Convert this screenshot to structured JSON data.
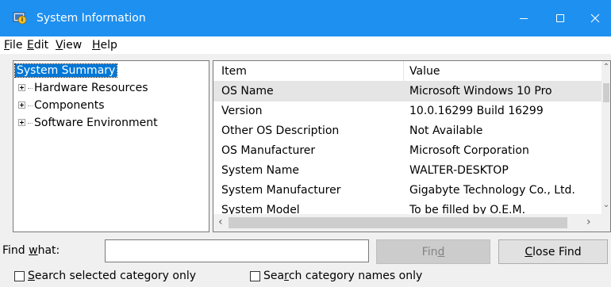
{
  "window": {
    "title": "System Information",
    "titlebar_color": "#1e90f0",
    "icons": [
      "system-info-icon",
      "minimize-icon",
      "maximize-icon",
      "close-icon"
    ]
  },
  "menu": {
    "file": {
      "mnemonic": "F",
      "rest": "ile"
    },
    "edit": {
      "mnemonic": "E",
      "rest": "dit"
    },
    "view": {
      "mnemonic": "V",
      "rest": "iew"
    },
    "help": {
      "mnemonic": "H",
      "rest": "elp"
    }
  },
  "tree": {
    "root": "System Summary",
    "children": [
      "Hardware Resources",
      "Components",
      "Software Environment"
    ]
  },
  "list": {
    "columns": [
      "Item",
      "Value"
    ],
    "rows": [
      {
        "item": "OS Name",
        "value": "Microsoft Windows 10 Pro"
      },
      {
        "item": "Version",
        "value": "10.0.16299 Build 16299"
      },
      {
        "item": "Other OS Description",
        "value": "Not Available"
      },
      {
        "item": "OS Manufacturer",
        "value": "Microsoft Corporation"
      },
      {
        "item": "System Name",
        "value": "WALTER-DESKTOP"
      },
      {
        "item": "System Manufacturer",
        "value": "Gigabyte Technology Co., Ltd."
      },
      {
        "item": "System Model",
        "value": "To be filled by O.E.M."
      }
    ],
    "selected_row": 0,
    "selection_color": "#e5e5e5"
  },
  "find": {
    "label_pre": "Find ",
    "label_mn": "w",
    "label_post": "hat:",
    "input_value": "",
    "find_pre": "Fin",
    "find_mn": "d",
    "close_mn": "C",
    "close_post": "lose Find",
    "chk1_mn": "S",
    "chk1_post": "earch selected category only",
    "chk1_checked": false,
    "chk2_pre": "Sea",
    "chk2_mn": "r",
    "chk2_post": "ch category names only",
    "chk2_checked": false
  }
}
